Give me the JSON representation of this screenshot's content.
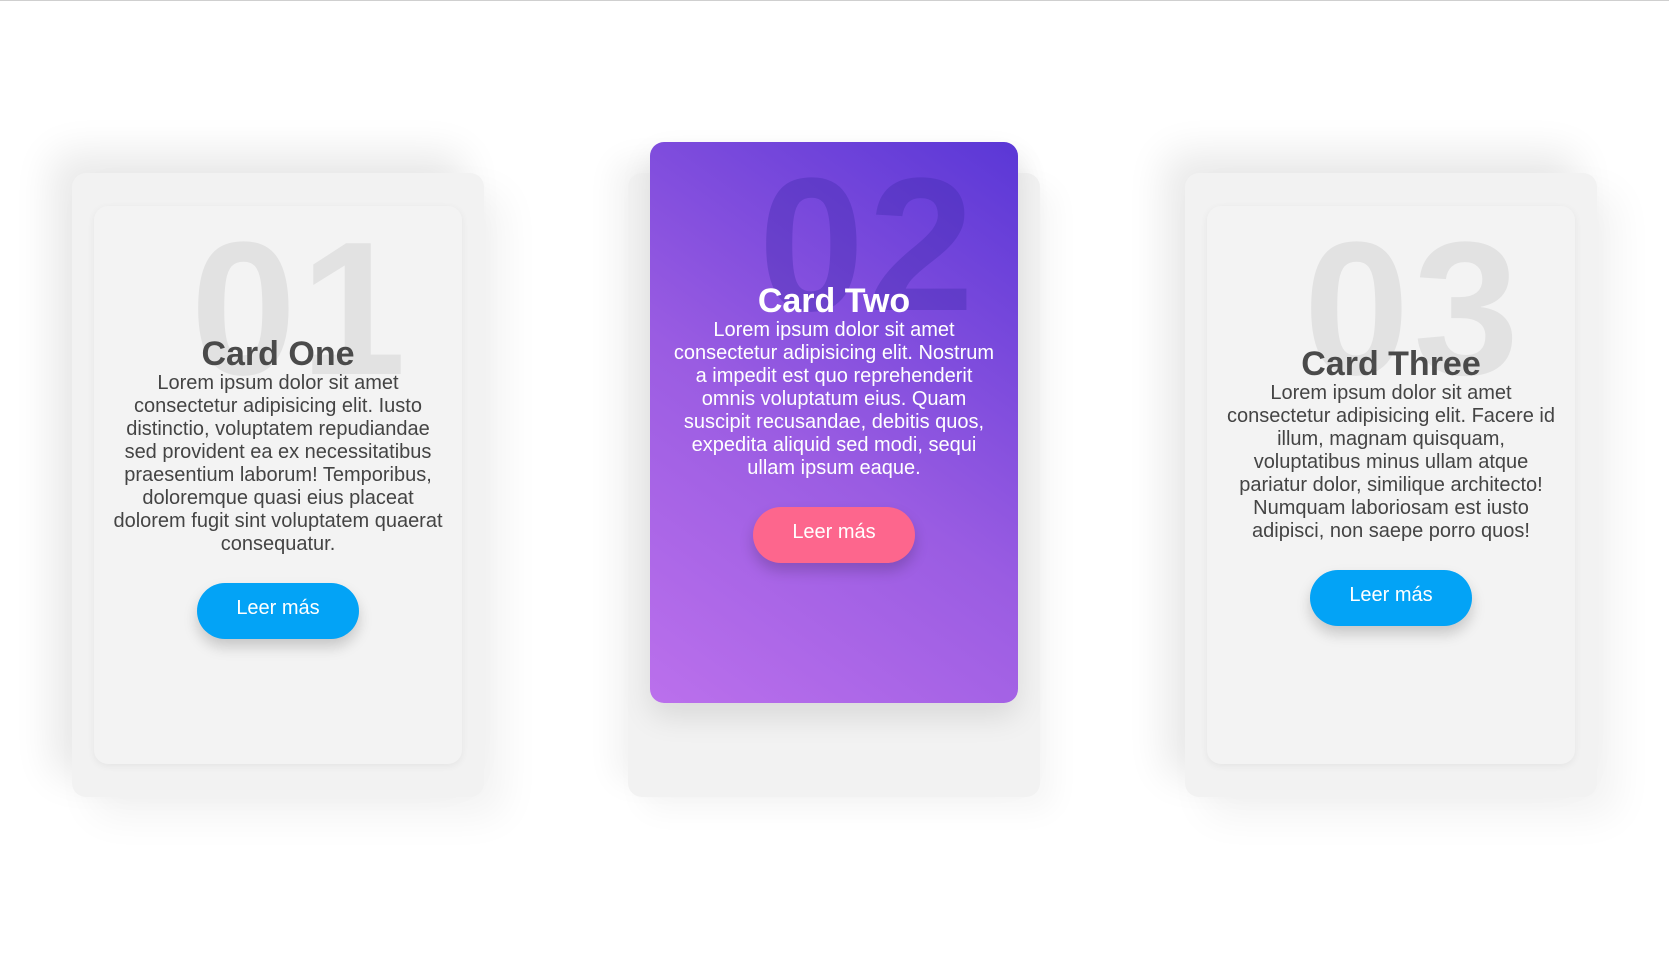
{
  "colors": {
    "card_background": "#f3f3f3",
    "featured_gradient_start": "#bb70ec",
    "featured_gradient_end": "#5a37d6",
    "button_blue": "#03a3f6",
    "button_pink": "#fd668d"
  },
  "cards": [
    {
      "number": "01",
      "title": "Card One",
      "text": "Lorem ipsum dolor sit amet consectetur adipisicing elit. Iusto distinctio, voluptatem repudiandae sed provident ea ex necessitatibus praesentium laborum! Temporibus, doloremque quasi eius placeat dolorem fugit sint voluptatem quaerat consequatur.",
      "button_label": "Leer más"
    },
    {
      "number": "02",
      "title": "Card Two",
      "text": "Lorem ipsum dolor sit amet consectetur adipisicing elit. Nostrum a impedit est quo reprehenderit omnis voluptatum eius. Quam suscipit recusandae, debitis quos, expedita aliquid sed modi, sequi ullam ipsum eaque.",
      "button_label": "Leer más"
    },
    {
      "number": "03",
      "title": "Card Three",
      "text": "Lorem ipsum dolor sit amet consectetur adipisicing elit. Facere id illum, magnam quisquam, voluptatibus minus ullam atque pariatur dolor, similique architecto! Numquam laboriosam est iusto adipisci, non saepe porro quos!",
      "button_label": "Leer más"
    }
  ]
}
